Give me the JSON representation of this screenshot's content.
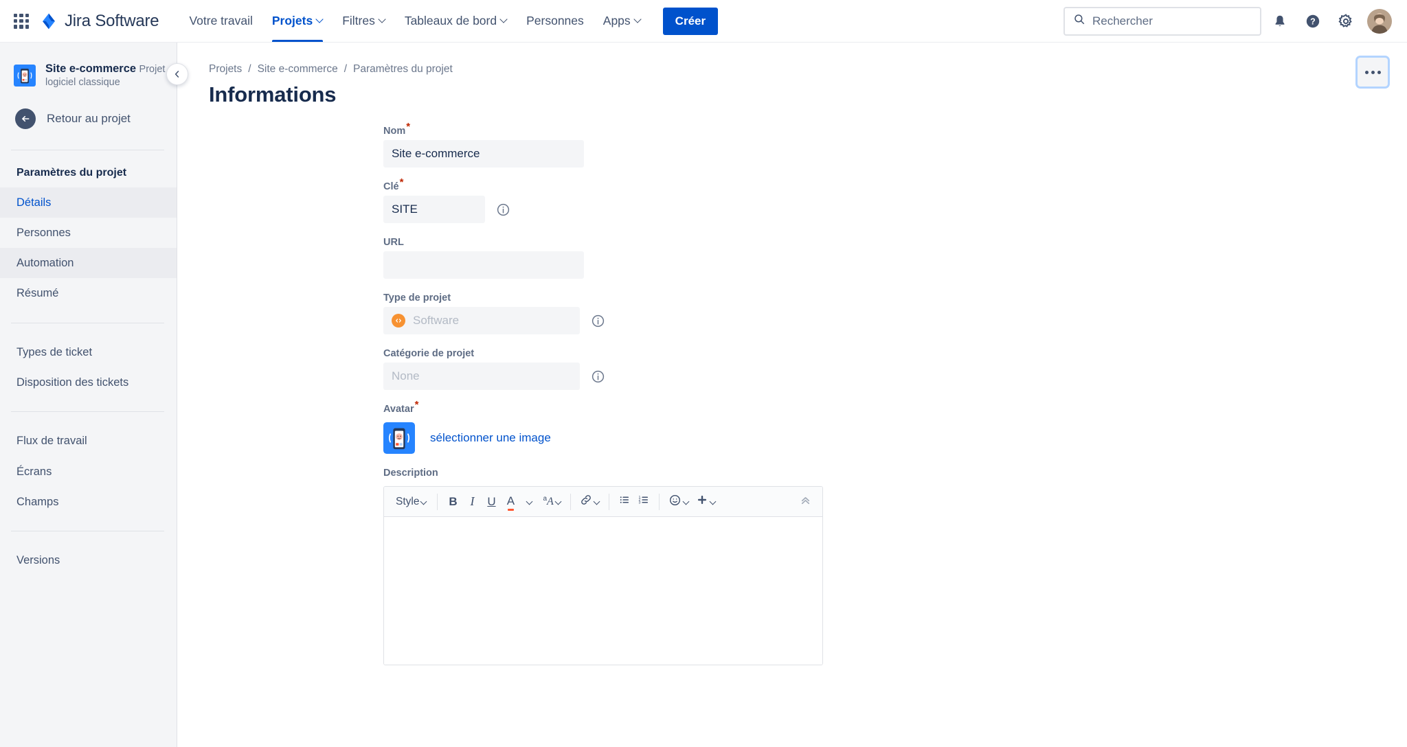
{
  "topnav": {
    "app_switcher": "app-switcher",
    "brand": "Jira Software",
    "items": [
      {
        "label": "Votre travail",
        "has_chevron": false,
        "active": false
      },
      {
        "label": "Projets",
        "has_chevron": true,
        "active": true
      },
      {
        "label": "Filtres",
        "has_chevron": true,
        "active": false
      },
      {
        "label": "Tableaux de bord",
        "has_chevron": true,
        "active": false
      },
      {
        "label": "Personnes",
        "has_chevron": false,
        "active": false
      },
      {
        "label": "Apps",
        "has_chevron": true,
        "active": false
      }
    ],
    "create_label": "Créer",
    "search_placeholder": "Rechercher",
    "search_value": "",
    "notifications_icon": "notifications-icon",
    "help_icon": "help-icon",
    "settings_icon": "settings-icon",
    "avatar": "user-avatar"
  },
  "sidebar": {
    "project_name": "Site e-commerce",
    "project_type": "Projet logiciel classique",
    "back_label": "Retour au projet",
    "settings_heading": "Paramètres du projet",
    "group1": [
      {
        "label": "Détails",
        "state": "active"
      },
      {
        "label": "Personnes",
        "state": ""
      },
      {
        "label": "Automation",
        "state": "hovered"
      },
      {
        "label": "Résumé",
        "state": ""
      }
    ],
    "group2": [
      {
        "label": "Types de ticket",
        "state": ""
      },
      {
        "label": "Disposition des tickets",
        "state": ""
      }
    ],
    "group3": [
      {
        "label": "Flux de travail",
        "state": ""
      },
      {
        "label": "Écrans",
        "state": ""
      },
      {
        "label": "Champs",
        "state": ""
      }
    ],
    "group4": [
      {
        "label": "Versions",
        "state": ""
      }
    ],
    "collapse_icon": "chevron-left-icon"
  },
  "main": {
    "breadcrumb": [
      "Projets",
      "Site e-commerce",
      "Paramètres du projet"
    ],
    "breadcrumb_separator": "/",
    "page_title": "Informations",
    "more_actions": "more-actions-button"
  },
  "form": {
    "name": {
      "label": "Nom",
      "required": true,
      "value": "Site e-commerce",
      "placeholder": ""
    },
    "key": {
      "label": "Clé",
      "required": true,
      "value": "SITE",
      "placeholder": "",
      "has_info": true
    },
    "url": {
      "label": "URL",
      "required": false,
      "value": "",
      "placeholder": ""
    },
    "project_type": {
      "label": "Type de projet",
      "required": false,
      "value": "Software",
      "has_info": true,
      "icon": "software-icon",
      "icon_color": "#f79232"
    },
    "project_category": {
      "label": "Catégorie de projet",
      "required": false,
      "value": "None",
      "has_info": true
    },
    "avatar": {
      "label": "Avatar",
      "required": true,
      "link_label": "sélectionner une image"
    },
    "description": {
      "label": "Description",
      "value": "",
      "toolbar": [
        {
          "name": "style-dropdown",
          "label": "Style",
          "type": "text-chevron"
        },
        {
          "name": "separator",
          "type": "sep"
        },
        {
          "name": "bold-button",
          "label": "B",
          "type": "bold"
        },
        {
          "name": "italic-button",
          "label": "I",
          "type": "italic"
        },
        {
          "name": "underline-button",
          "label": "U",
          "type": "underline"
        },
        {
          "name": "text-color-button",
          "label": "A",
          "type": "color-chevron"
        },
        {
          "name": "text-style-more-button",
          "label": "A",
          "type": "more-text-chevron"
        },
        {
          "name": "separator",
          "type": "sep"
        },
        {
          "name": "link-button",
          "label": "",
          "type": "link-chevron"
        },
        {
          "name": "separator",
          "type": "sep"
        },
        {
          "name": "bullet-list-button",
          "label": "",
          "type": "bullet"
        },
        {
          "name": "numbered-list-button",
          "label": "",
          "type": "numbered"
        },
        {
          "name": "separator",
          "type": "sep"
        },
        {
          "name": "emoji-button",
          "label": "",
          "type": "emoji-chevron"
        },
        {
          "name": "insert-more-button",
          "label": "",
          "type": "plus-chevron"
        },
        {
          "name": "collapse-toolbar-button",
          "label": "",
          "type": "collapse"
        }
      ]
    }
  },
  "colors": {
    "brand_blue": "#0052cc",
    "link_blue": "#0052cc",
    "sidebar_bg": "#f4f5f7",
    "required_red": "#bf2600",
    "software_orange": "#f79232",
    "text_dark": "#172b4d",
    "text_muted": "#6b778c"
  }
}
